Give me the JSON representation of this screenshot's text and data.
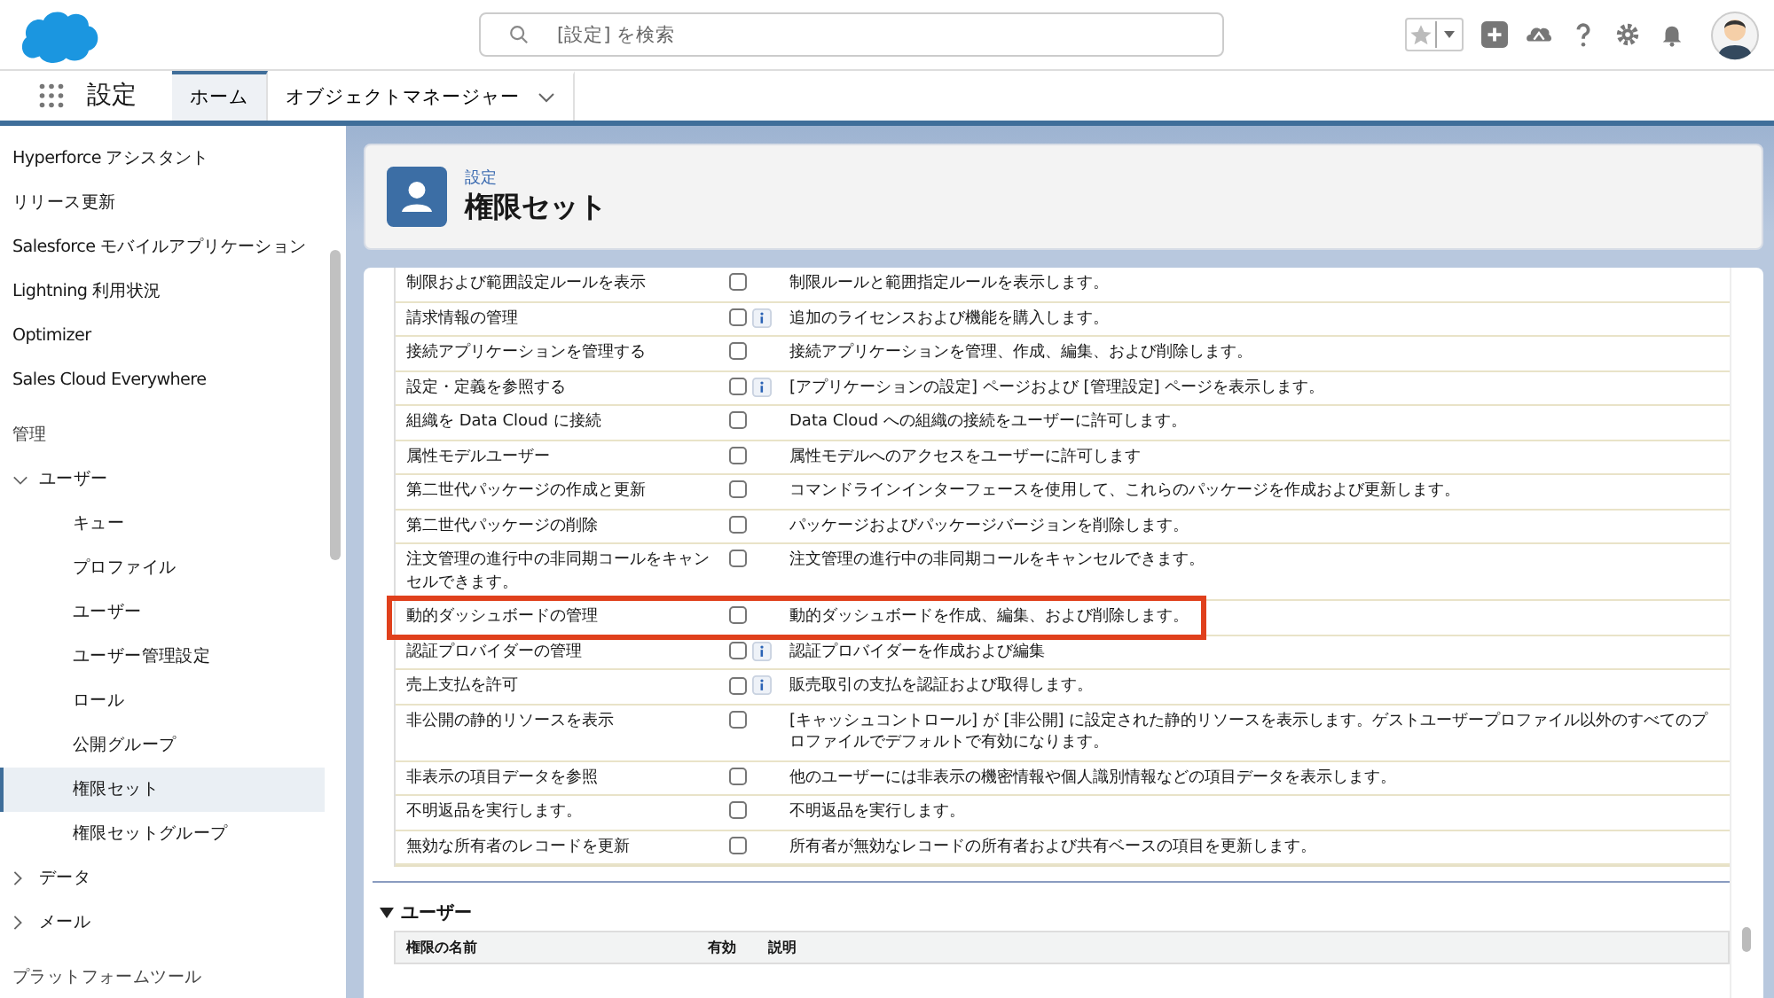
{
  "header": {
    "search": {
      "placeholder": "[設定] を検索"
    }
  },
  "nav": {
    "app_name": "設定",
    "tabs": [
      {
        "label": "ホーム",
        "selected": true,
        "menu": false
      },
      {
        "label": "オブジェクトマネージャー",
        "selected": false,
        "menu": true
      }
    ]
  },
  "sidebar": {
    "items": [
      {
        "kind": "link",
        "label": "Hyperforce アシスタント"
      },
      {
        "kind": "link",
        "label": "リリース更新"
      },
      {
        "kind": "link",
        "label": "Salesforce モバイルアプリケーション"
      },
      {
        "kind": "link",
        "label": "Lightning 利用状況"
      },
      {
        "kind": "link",
        "label": "Optimizer"
      },
      {
        "kind": "link",
        "label": "Sales Cloud Everywhere"
      },
      {
        "kind": "heading",
        "label": "管理"
      },
      {
        "kind": "group",
        "label": "ユーザー",
        "expanded": true,
        "children": [
          {
            "label": "キュー",
            "selected": false
          },
          {
            "label": "プロファイル",
            "selected": false
          },
          {
            "label": "ユーザー",
            "selected": false
          },
          {
            "label": "ユーザー管理設定",
            "selected": false
          },
          {
            "label": "ロール",
            "selected": false
          },
          {
            "label": "公開グループ",
            "selected": false
          },
          {
            "label": "権限セット",
            "selected": true
          },
          {
            "label": "権限セットグループ",
            "selected": false
          }
        ]
      },
      {
        "kind": "group",
        "label": "データ",
        "expanded": false
      },
      {
        "kind": "group",
        "label": "メール",
        "expanded": false
      },
      {
        "kind": "heading",
        "label": "プラットフォームツール"
      }
    ]
  },
  "page_header": {
    "breadcrumb": "設定",
    "title": "権限セット"
  },
  "permissions": {
    "rows": [
      {
        "name": "制限および範囲設定ルールを表示",
        "checked": false,
        "info": false,
        "highlighted": false,
        "description": "制限ルールと範囲指定ルールを表示します。"
      },
      {
        "name": "請求情報の管理",
        "checked": false,
        "info": true,
        "highlighted": false,
        "description": "追加のライセンスおよび機能を購入します。"
      },
      {
        "name": "接続アプリケーションを管理する",
        "checked": false,
        "info": false,
        "highlighted": false,
        "description": "接続アプリケーションを管理、作成、編集、および削除します。"
      },
      {
        "name": "設定・定義を参照する",
        "checked": false,
        "info": true,
        "highlighted": false,
        "description": "[アプリケーションの設定] ページおよび [管理設定] ページを表示します。"
      },
      {
        "name": "組織を Data Cloud に接続",
        "checked": false,
        "info": false,
        "highlighted": false,
        "description": "Data Cloud への組織の接続をユーザーに許可します。"
      },
      {
        "name": "属性モデルユーザー",
        "checked": false,
        "info": false,
        "highlighted": false,
        "description": "属性モデルへのアクセスをユーザーに許可します"
      },
      {
        "name": "第二世代パッケージの作成と更新",
        "checked": false,
        "info": false,
        "highlighted": false,
        "description": "コマンドラインインターフェースを使用して、これらのパッケージを作成および更新します。"
      },
      {
        "name": "第二世代パッケージの削除",
        "checked": false,
        "info": false,
        "highlighted": false,
        "description": "パッケージおよびパッケージバージョンを削除します。"
      },
      {
        "name": "注文管理の進行中の非同期コールをキャンセルできます。",
        "checked": false,
        "info": false,
        "highlighted": false,
        "description": "注文管理の進行中の非同期コールをキャンセルできます。"
      },
      {
        "name": "動的ダッシュボードの管理",
        "checked": false,
        "info": false,
        "highlighted": true,
        "description": "動的ダッシュボードを作成、編集、および削除します。"
      },
      {
        "name": "認証プロバイダーの管理",
        "checked": false,
        "info": true,
        "highlighted": false,
        "description": "認証プロバイダーを作成および編集"
      },
      {
        "name": "売上支払を許可",
        "checked": false,
        "info": true,
        "highlighted": false,
        "description": "販売取引の支払を認証および取得します。"
      },
      {
        "name": "非公開の静的リソースを表示",
        "checked": false,
        "info": false,
        "highlighted": false,
        "description": "[キャッシュコントロール] が [非公開] に設定された静的リソースを表示します。ゲストユーザープロファイル以外のすべてのプロファイルでデフォルトで有効になります。"
      },
      {
        "name": "非表示の項目データを参照",
        "checked": false,
        "info": false,
        "highlighted": false,
        "description": "他のユーザーには非表示の機密情報や個人識別情報などの項目データを表示します。"
      },
      {
        "name": "不明返品を実行します。",
        "checked": false,
        "info": false,
        "highlighted": false,
        "description": "不明返品を実行します。"
      },
      {
        "name": "無効な所有者のレコードを更新",
        "checked": false,
        "info": false,
        "highlighted": false,
        "description": "所有者が無効なレコードの所有者および共有ベースの項目を更新します。"
      }
    ]
  },
  "user_section": {
    "title": "ユーザー",
    "expanded": true,
    "columns": [
      "権限の名前",
      "有効",
      "説明"
    ]
  }
}
